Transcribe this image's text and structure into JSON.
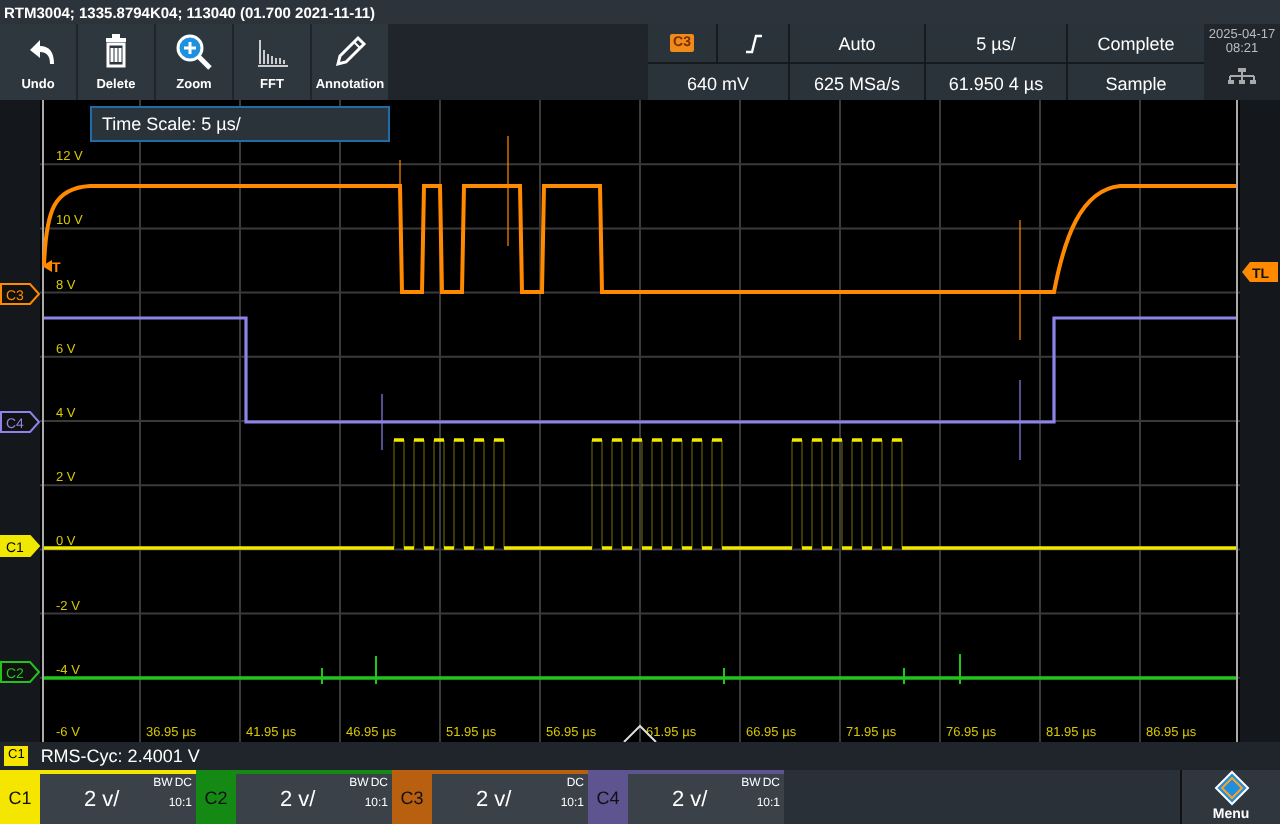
{
  "title_bar": {
    "text": "RTM3004; 1335.8794K04; 113040 (01.700 2021-11-11)"
  },
  "toolbar": [
    {
      "kind": "undo",
      "label": "Undo"
    },
    {
      "kind": "delete",
      "label": "Delete"
    },
    {
      "kind": "zoom",
      "label": "Zoom"
    },
    {
      "kind": "fft",
      "label": "FFT"
    },
    {
      "kind": "annotation",
      "label": "Annotation"
    }
  ],
  "acquisition": {
    "channel": "C3",
    "trigger_mode": "Auto",
    "time_scale": "5 µs/",
    "state": "Complete",
    "trigger_level": "640 mV",
    "sample_rate": "625 MSa/s",
    "time_position": "61.950 4 µs",
    "mode": "Sample"
  },
  "clock": {
    "date": "2025-04-17",
    "time": "08:21"
  },
  "graph": {
    "info_box": "Time Scale: 5 µs/",
    "y_labels": [
      "12 V",
      "10 V",
      "8 V",
      "6 V",
      "4 V",
      "2 V",
      "0 V",
      "-2 V",
      "-4 V",
      "-6 V"
    ],
    "x_labels": [
      "36.95 µs",
      "41.95 µs",
      "46.95 µs",
      "51.95 µs",
      "56.95 µs",
      "61.95 µs",
      "66.95 µs",
      "71.95 µs",
      "76.95 µs",
      "81.95 µs",
      "86.95 µs"
    ],
    "trigger_marker": "T",
    "trigger_level_marker": "TL",
    "traces": [
      {
        "channel": "C3",
        "color": "#ff8a00",
        "selected": false
      },
      {
        "channel": "C4",
        "color": "#8c84e8",
        "selected": false
      },
      {
        "channel": "C1",
        "color": "#f0e800",
        "selected": true
      },
      {
        "channel": "C2",
        "color": "#22c41c",
        "selected": false
      }
    ]
  },
  "measurement": {
    "channel": "C1",
    "color": "#f5e600",
    "text": "RMS-Cyc: 2.4001 V"
  },
  "channels": [
    {
      "label": "C1",
      "color": "#f5e600",
      "scale": "2 v/",
      "bandwidth": "BW",
      "coupling": "DC",
      "probe": "10:1"
    },
    {
      "label": "C2",
      "color": "#148a14",
      "scale": "2 v/",
      "bandwidth": "BW",
      "coupling": "DC",
      "probe": "10:1"
    },
    {
      "label": "C3",
      "color": "#b8600f",
      "scale": "2 v/",
      "coupling": "DC",
      "probe": "10:1"
    },
    {
      "label": "C4",
      "color": "#5e548f",
      "scale": "2 v/",
      "bandwidth": "BW",
      "coupling": "DC",
      "probe": "10:1"
    }
  ],
  "menu_button": {
    "label": "Menu"
  }
}
